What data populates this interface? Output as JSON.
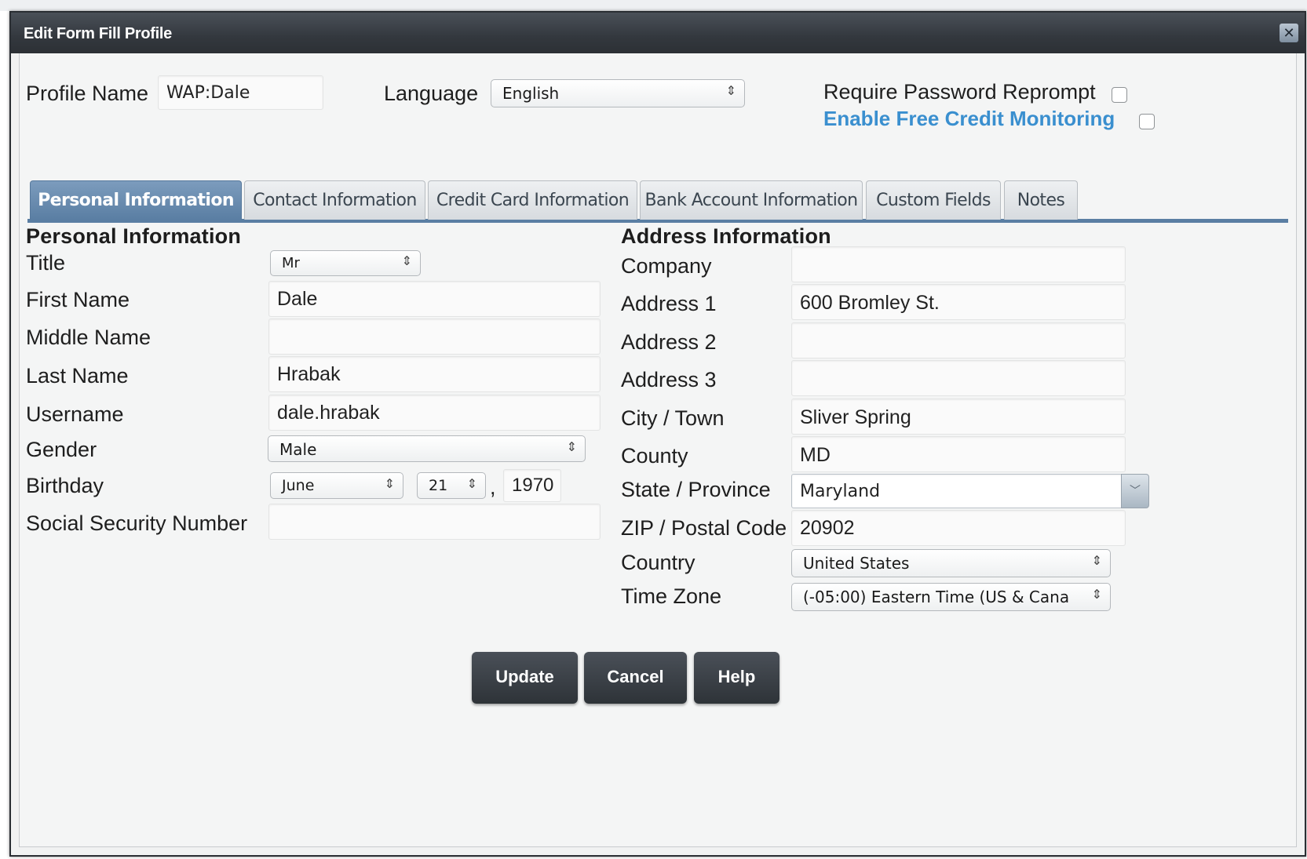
{
  "dialog": {
    "title": "Edit Form Fill Profile",
    "close_icon": "close-icon"
  },
  "header": {
    "profile_name_label": "Profile Name",
    "profile_name_value": "WAP:Dale",
    "language_label": "Language",
    "language_value": "English",
    "require_password_label": "Require Password Reprompt",
    "require_password_checked": false,
    "credit_monitoring_label": "Enable Free Credit Monitoring",
    "credit_monitoring_checked": false
  },
  "tabs": [
    {
      "label": "Personal Information",
      "active": true
    },
    {
      "label": "Contact Information",
      "active": false
    },
    {
      "label": "Credit Card Information",
      "active": false
    },
    {
      "label": "Bank Account Information",
      "active": false
    },
    {
      "label": "Custom Fields",
      "active": false
    },
    {
      "label": "Notes",
      "active": false
    }
  ],
  "personal": {
    "section_title": "Personal Information",
    "title_label": "Title",
    "title_value": "Mr",
    "first_name_label": "First Name",
    "first_name_value": "Dale",
    "middle_name_label": "Middle Name",
    "middle_name_value": "",
    "last_name_label": "Last Name",
    "last_name_value": "Hrabak",
    "username_label": "Username",
    "username_value": "dale.hrabak",
    "gender_label": "Gender",
    "gender_value": "Male",
    "birthday_label": "Birthday",
    "birthday_month": "June",
    "birthday_day": "21",
    "birthday_separator": ",",
    "birthday_year": "1970",
    "ssn_label": "Social Security Number",
    "ssn_value": ""
  },
  "address": {
    "section_title": "Address Information",
    "company_label": "Company",
    "company_value": "",
    "address1_label": "Address 1",
    "address1_value": "600 Bromley St.",
    "address2_label": "Address 2",
    "address2_value": "",
    "address3_label": "Address 3",
    "address3_value": "",
    "city_label": "City / Town",
    "city_value": "Sliver Spring",
    "county_label": "County",
    "county_value": "MD",
    "state_label": "State / Province",
    "state_value": "Maryland",
    "zip_label": "ZIP / Postal Code",
    "zip_value": "20902",
    "country_label": "Country",
    "country_value": "United States",
    "timezone_label": "Time Zone",
    "timezone_value": "(-05:00) Eastern Time (US & Cana"
  },
  "buttons": {
    "update": "Update",
    "cancel": "Cancel",
    "help": "Help"
  },
  "icons": {
    "select_arrows": "⇕",
    "combo_dropdown": "chevron-down-icon"
  },
  "colors": {
    "titlebar": "#33383e",
    "active_tab": "#5a7ea3",
    "link_blue": "#3a8fcf",
    "button": "#33383e"
  }
}
